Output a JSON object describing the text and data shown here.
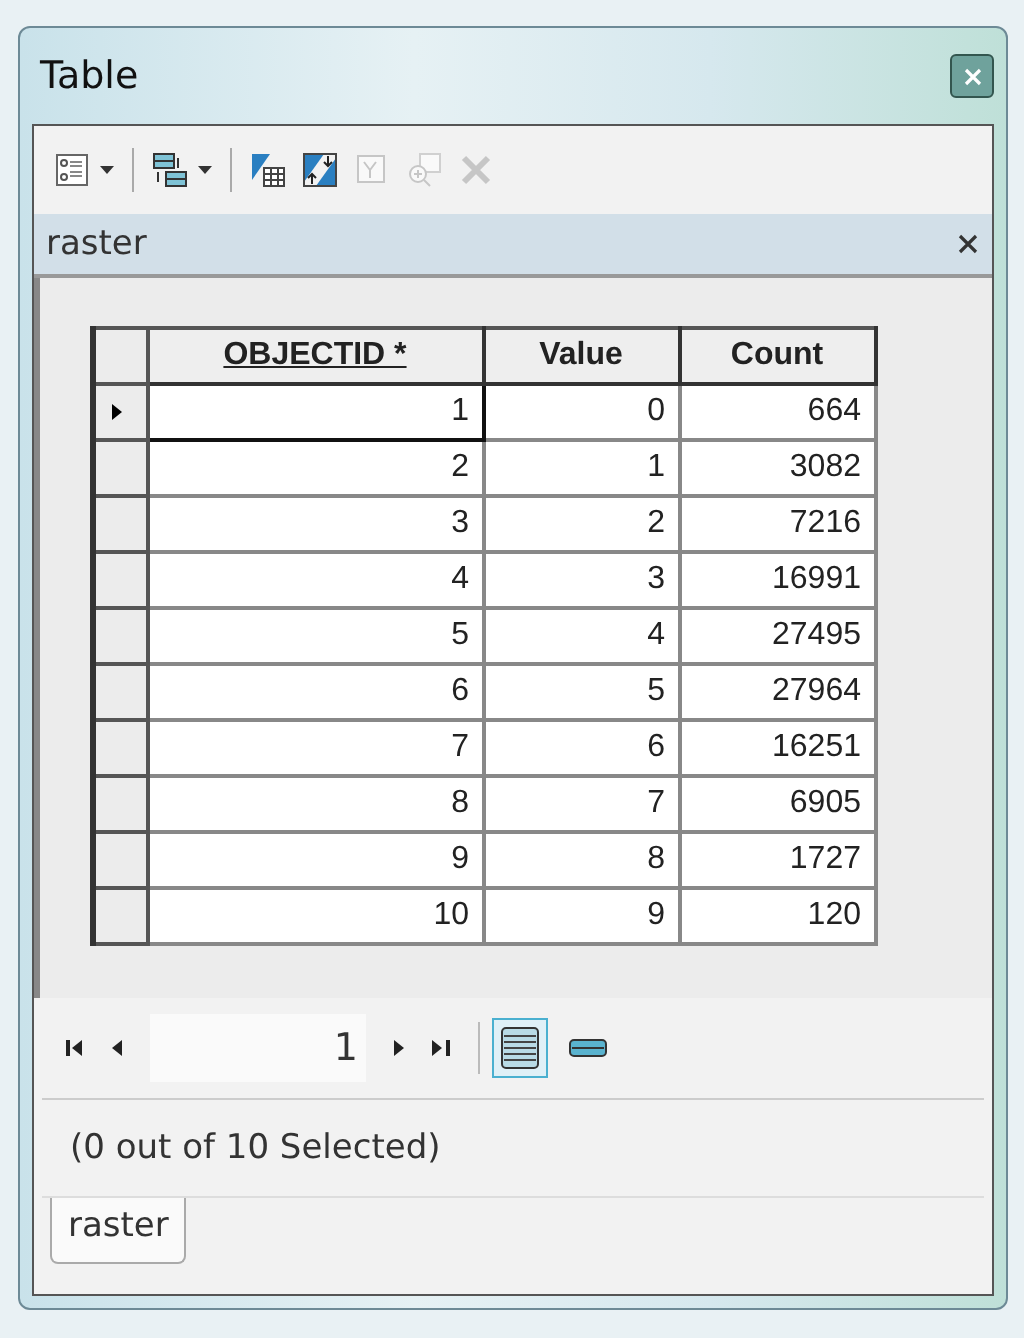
{
  "window": {
    "title": "Table"
  },
  "toolbar": [
    {
      "kind": "options",
      "disabled": false,
      "dropdown": true
    },
    {
      "kind": "related",
      "disabled": false,
      "dropdown": true
    },
    {
      "kind": "select-by",
      "disabled": false,
      "dropdown": false
    },
    {
      "kind": "switch",
      "disabled": false,
      "dropdown": false
    },
    {
      "kind": "clear",
      "disabled": true,
      "dropdown": false
    },
    {
      "kind": "zoom",
      "disabled": true,
      "dropdown": false
    },
    {
      "kind": "delete",
      "disabled": true,
      "dropdown": false
    }
  ],
  "panel": {
    "title": "raster"
  },
  "table": {
    "columns": [
      "OBJECTID *",
      "Value",
      "Count"
    ],
    "rows": [
      {
        "cells": [
          "1",
          "0",
          "664"
        ],
        "current": true
      },
      {
        "cells": [
          "2",
          "1",
          "3082"
        ],
        "current": false
      },
      {
        "cells": [
          "3",
          "2",
          "7216"
        ],
        "current": false
      },
      {
        "cells": [
          "4",
          "3",
          "16991"
        ],
        "current": false
      },
      {
        "cells": [
          "5",
          "4",
          "27495"
        ],
        "current": false
      },
      {
        "cells": [
          "6",
          "5",
          "27964"
        ],
        "current": false
      },
      {
        "cells": [
          "7",
          "6",
          "16251"
        ],
        "current": false
      },
      {
        "cells": [
          "8",
          "7",
          "6905"
        ],
        "current": false
      },
      {
        "cells": [
          "9",
          "8",
          "1727"
        ],
        "current": false
      },
      {
        "cells": [
          "10",
          "9",
          "120"
        ],
        "current": false
      }
    ]
  },
  "navigation": {
    "record": "1",
    "views": [
      {
        "kind": "all",
        "selected": true
      },
      {
        "kind": "selected",
        "selected": false
      }
    ]
  },
  "status": "(0 out of 10 Selected)",
  "tabs": [
    {
      "label": "raster",
      "selected": true
    }
  ]
}
